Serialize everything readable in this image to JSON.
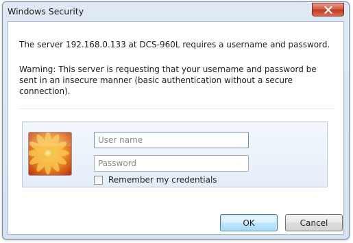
{
  "window": {
    "title": "Windows Security"
  },
  "message": {
    "server_line": "The server 192.168.0.133 at DCS-960L requires a username and password.",
    "warning": "Warning: This server is requesting that your username and password be sent in an insecure manner (basic authentication without a secure connection)."
  },
  "credentials": {
    "username_placeholder": "User name",
    "username_value": "",
    "password_placeholder": "Password",
    "password_value": "",
    "remember_label": "Remember my credentials",
    "remember_checked": false,
    "tile_icon": "flower-user-tile-icon"
  },
  "buttons": {
    "ok_label": "OK",
    "cancel_label": "Cancel"
  },
  "colors": {
    "accent_blue": "#3c7fb1",
    "close_red": "#c0391f"
  }
}
